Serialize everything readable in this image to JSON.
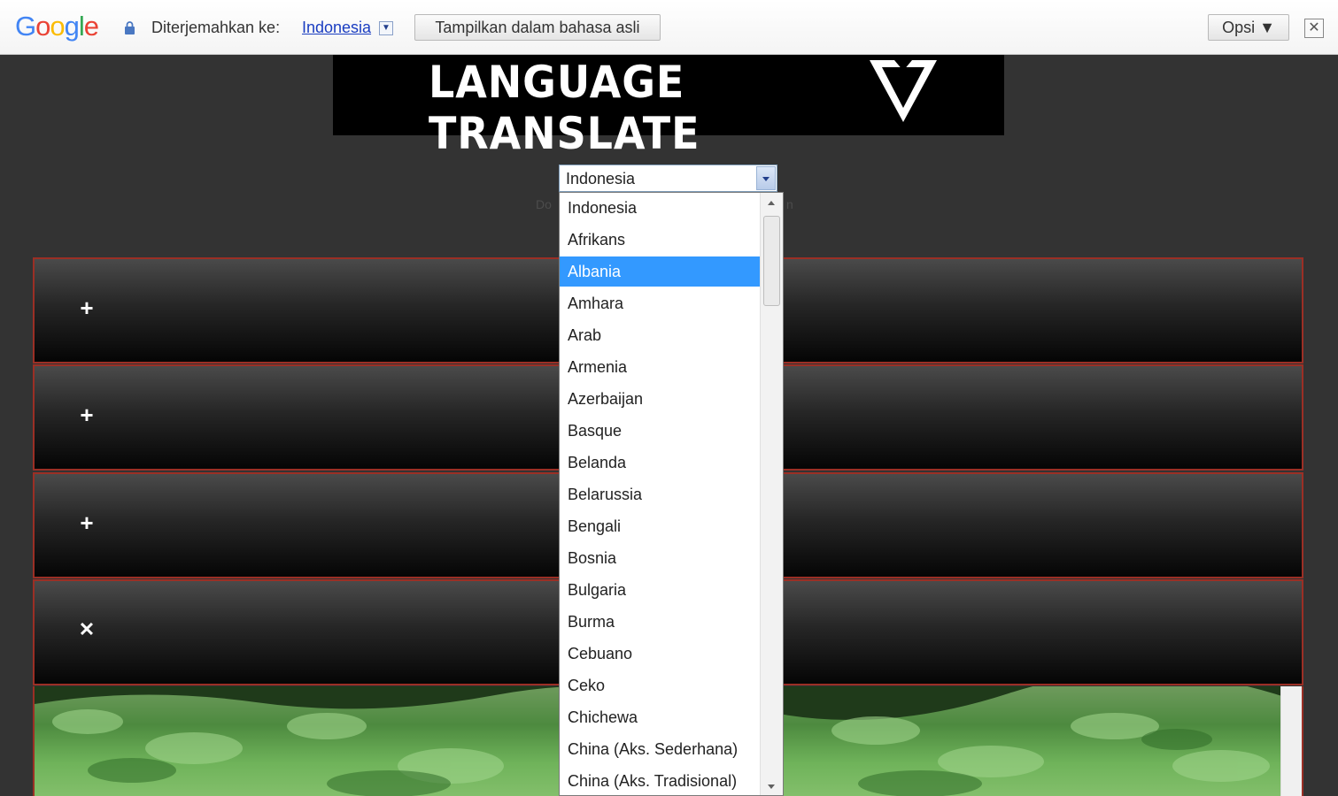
{
  "translate_bar": {
    "logo_letters": [
      {
        "ch": "G",
        "color": "#4285f4"
      },
      {
        "ch": "o",
        "color": "#ea4335"
      },
      {
        "ch": "o",
        "color": "#fbbc05"
      },
      {
        "ch": "g",
        "color": "#4285f4"
      },
      {
        "ch": "l",
        "color": "#34a853"
      },
      {
        "ch": "e",
        "color": "#ea4335"
      }
    ],
    "label": "Diterjemahkan ke:",
    "language": "Indonesia",
    "show_original": "Tampilkan dalam bahasa asli",
    "options": "Opsi ▼",
    "close": "✕"
  },
  "banner": {
    "title": "LANGUAGE TRANSLATE"
  },
  "language_select": {
    "value": "Indonesia",
    "selected_option": "Albania",
    "options": [
      "Indonesia",
      "Afrikans",
      "Albania",
      "Amhara",
      "Arab",
      "Armenia",
      "Azerbaijan",
      "Basque",
      "Belanda",
      "Belarussia",
      "Bengali",
      "Bosnia",
      "Bulgaria",
      "Burma",
      "Cebuano",
      "Ceko",
      "Chichewa",
      "China (Aks. Sederhana)",
      "China (Aks. Tradisional)"
    ]
  },
  "panels": [
    {
      "icon": "+"
    },
    {
      "icon": "+"
    },
    {
      "icon": "+"
    },
    {
      "icon": "✕"
    }
  ],
  "colors": {
    "page_bg": "#333333",
    "panel_border": "#9b2f25",
    "selected_bg": "#3399ff"
  }
}
